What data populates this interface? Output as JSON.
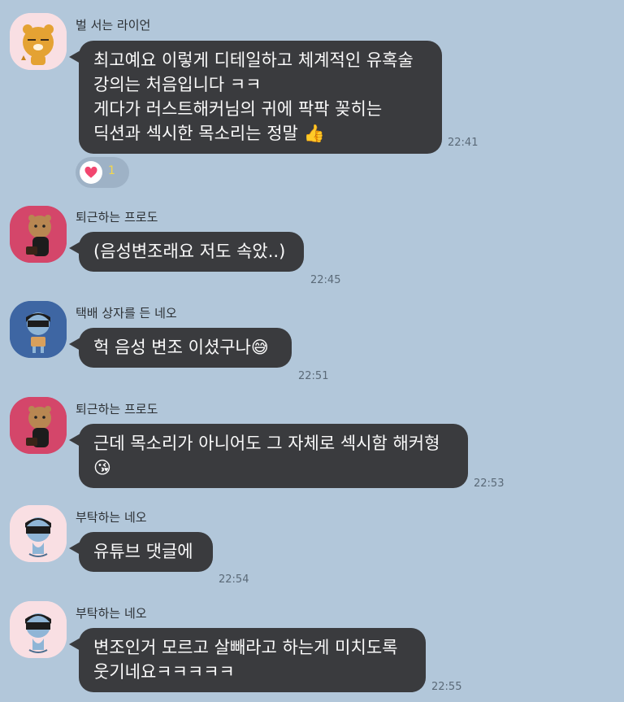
{
  "colors": {
    "background": "#b2c7da",
    "bubble": "#3a3b3e",
    "bubble_text": "#fafafa",
    "reaction_heart": "#f2466f",
    "reaction_count": "#f5d84a"
  },
  "messages": [
    {
      "sender": "벌 서는 라이언",
      "avatar": "ryan-character-icon",
      "lines": [
        "최고예요 이렇게 디테일하고 체계적인 유혹술",
        "강의는 처음입니다 ㅋㅋ",
        "게다가 러스트해커님의 귀에 팍팍 꽂히는",
        "딕션과 섹시한 목소리는 정말 👍"
      ],
      "time": "22:41",
      "reaction": {
        "icon": "heart-icon",
        "count": "1"
      }
    },
    {
      "sender": "퇴근하는 프로도",
      "avatar": "frodo-character-icon",
      "lines": [
        "(음성변조래요 저도 속았..)"
      ],
      "time": "22:45"
    },
    {
      "sender": "택배 상자를 든 네오",
      "avatar": "neo-character-icon",
      "lines": [
        "헉 음성 변조 이셨구나😅"
      ],
      "time": "22:51"
    },
    {
      "sender": "퇴근하는 프로도",
      "avatar": "frodo-character-icon",
      "lines": [
        "근데 목소리가 아니어도 그 자체로 섹시함 해커형",
        "😘"
      ],
      "time": "22:53"
    },
    {
      "sender": "부탁하는 네오",
      "avatar": "neo-character-icon",
      "lines": [
        "유튜브 댓글에"
      ],
      "time": "22:54"
    },
    {
      "sender": "부탁하는 네오",
      "avatar": "neo-character-icon",
      "lines": [
        "변조인거 모르고 살빼라고 하는게 미치도록",
        "웃기네요ㅋㅋㅋㅋㅋ"
      ],
      "time": "22:55"
    }
  ]
}
